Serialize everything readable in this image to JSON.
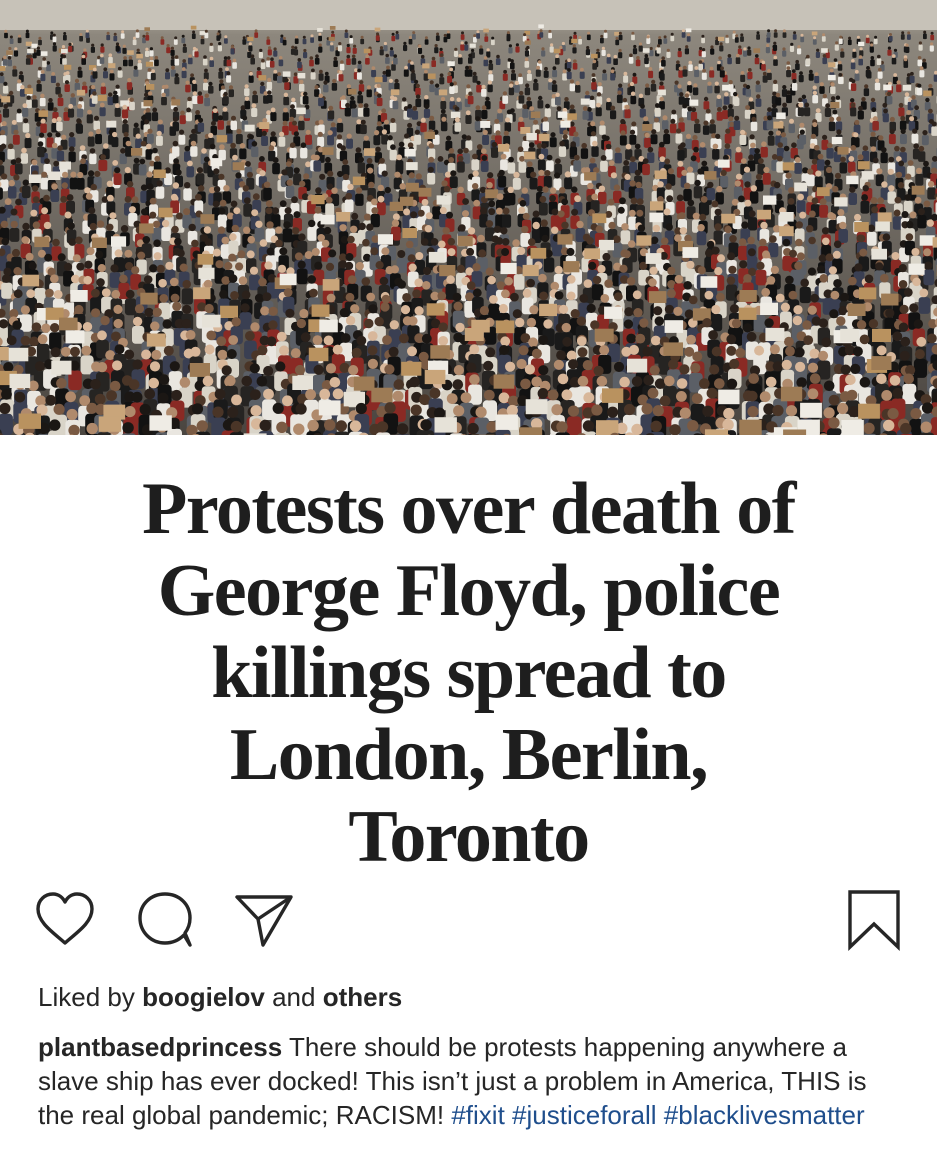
{
  "post": {
    "image": {
      "kind": "crowd-protest-photo",
      "dominant_colors": [
        "#2a2622",
        "#c9b08a",
        "#e8e4dc",
        "#8a8680"
      ]
    },
    "headline": {
      "lines": [
        "Protests over death of",
        "George Floyd, police",
        "killings spread to",
        "London, Berlin,",
        "Toronto"
      ]
    },
    "actions": {
      "like_icon": "heart-outline-icon",
      "comment_icon": "speech-bubble-icon",
      "share_icon": "paper-plane-icon",
      "save_icon": "bookmark-outline-icon"
    },
    "likes": {
      "prefix": "Liked by",
      "user": "boogielov",
      "joiner": "and",
      "others": "others"
    },
    "caption": {
      "username": "plantbasedprincess",
      "text": "There should be protests happening anywhere a slave ship has ever docked! This isn’t just a problem in America, THIS is the real global pandemic; RACISM!",
      "hashtags": [
        "#fixit",
        "#justiceforall",
        "#blacklivesmatter"
      ]
    },
    "colors": {
      "text": "#262626",
      "hashtag": "#1f4e8c",
      "headline": "#1e1e1e"
    }
  }
}
